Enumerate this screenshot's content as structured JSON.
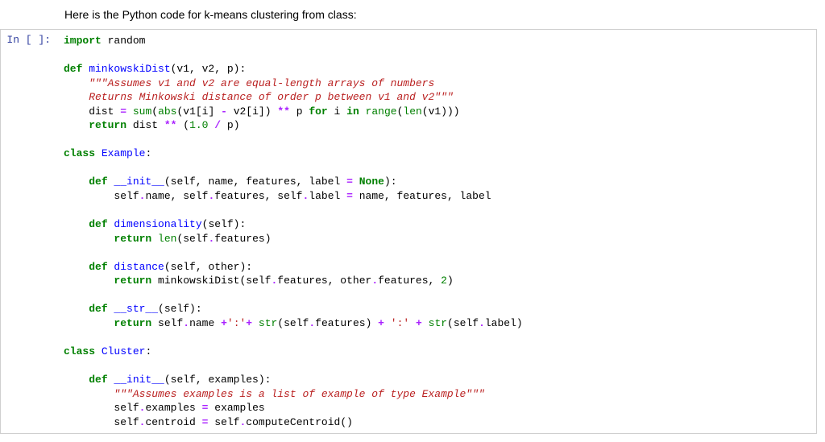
{
  "intro": "Here is the Python code for k-means clustering from class:",
  "prompt": "In [ ]:",
  "code": {
    "l1": {
      "kw_import": "import",
      "mod": " random"
    },
    "l2": {
      "kw_def": "def",
      "fn": " minkowskiDist",
      "sig": "(v1, v2, p):"
    },
    "l3": {
      "doc": "    \"\"\"Assumes v1 and v2 are equal-length arrays of numbers"
    },
    "l4": {
      "doc": "    Returns Minkowski distance of order p between v1 and v2\"\"\""
    },
    "l5": {
      "a": "    dist ",
      "op1": "=",
      "b": " ",
      "bi_sum": "sum",
      "c": "(",
      "bi_abs": "abs",
      "d": "(v1[i] ",
      "op2": "-",
      "e": " v2[i]) ",
      "op3": "**",
      "f": " p ",
      "kw_for": "for",
      "g": " i ",
      "kw_in": "in",
      "h": " ",
      "bi_range": "range",
      "i": "(",
      "bi_len": "len",
      "j": "(v1)))"
    },
    "l6": {
      "sp": "    ",
      "kw_return": "return",
      "a": " dist ",
      "op1": "**",
      "b": " (",
      "num1": "1.0",
      "c": " ",
      "op2": "/",
      "d": " p)"
    },
    "l7": {
      "kw_class": "class",
      "sp": " ",
      "cls": "Example",
      "colon": ":"
    },
    "l8": {
      "sp": "    ",
      "kw_def": "def",
      "fn": " __init__",
      "sig": "(self, name, features, label ",
      "op": "=",
      "sp2": " ",
      "none": "None",
      "end": "):"
    },
    "l9": {
      "a": "        self",
      "op1": ".",
      "b": "name, self",
      "op2": ".",
      "c": "features, self",
      "op3": ".",
      "d": "label ",
      "op4": "=",
      "e": " name, features, label"
    },
    "l10": {
      "sp": "    ",
      "kw_def": "def",
      "fn": " dimensionality",
      "sig": "(self):"
    },
    "l11": {
      "sp": "        ",
      "kw_return": "return",
      "a": " ",
      "bi_len": "len",
      "b": "(self",
      "op": ".",
      "c": "features)"
    },
    "l12": {
      "sp": "    ",
      "kw_def": "def",
      "fn": " distance",
      "sig": "(self, other):"
    },
    "l13": {
      "sp": "        ",
      "kw_return": "return",
      "a": " minkowskiDist(self",
      "op1": ".",
      "b": "features, other",
      "op2": ".",
      "c": "features, ",
      "num": "2",
      "d": ")"
    },
    "l14": {
      "sp": "    ",
      "kw_def": "def",
      "fn": " __str__",
      "sig": "(self):"
    },
    "l15": {
      "sp": "        ",
      "kw_return": "return",
      "a": " self",
      "op1": ".",
      "b": "name ",
      "op2": "+",
      "str1": "':'",
      "op3": "+",
      "c": " ",
      "bi_str": "str",
      "d": "(self",
      "op4": ".",
      "e": "features) ",
      "op5": "+",
      "f": " ",
      "str2": "':'",
      "g": " ",
      "op6": "+",
      "h": " ",
      "bi_str2": "str",
      "i": "(self",
      "op7": ".",
      "j": "label)"
    },
    "l16": {
      "kw_class": "class",
      "sp": " ",
      "cls": "Cluster",
      "colon": ":"
    },
    "l17": {
      "sp": "    ",
      "kw_def": "def",
      "fn": " __init__",
      "sig": "(self, examples):"
    },
    "l18": {
      "doc": "        \"\"\"Assumes examples is a list of example of type Example\"\"\""
    },
    "l19": {
      "a": "        self",
      "op1": ".",
      "b": "examples ",
      "op2": "=",
      "c": " examples"
    },
    "l20": {
      "a": "        self",
      "op1": ".",
      "b": "centroid ",
      "op2": "=",
      "c": " self",
      "op3": ".",
      "d": "computeCentroid()"
    }
  }
}
